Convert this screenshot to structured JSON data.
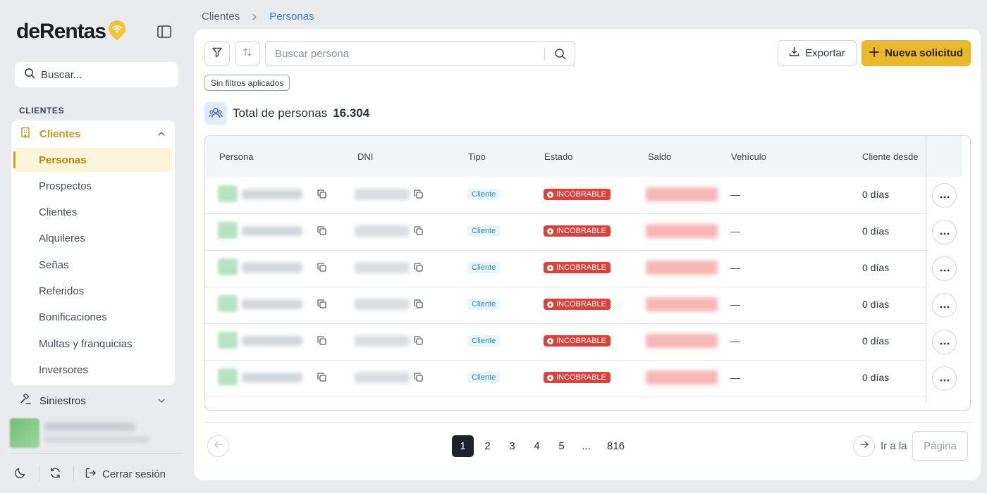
{
  "app": {
    "logo_text": "deRentas",
    "brand_color": "#e9b92a",
    "accent_color": "#3b7dd8"
  },
  "sidebar": {
    "search_placeholder": "Buscar...",
    "section_label": "CLIENTES",
    "group": {
      "label": "Clientes",
      "expanded": true,
      "items": [
        {
          "label": "Personas",
          "active": true
        },
        {
          "label": "Prospectos"
        },
        {
          "label": "Clientes"
        },
        {
          "label": "Alquileres"
        },
        {
          "label": "Señas"
        },
        {
          "label": "Referidos"
        },
        {
          "label": "Bonificaciones"
        },
        {
          "label": "Multas y franquicias"
        },
        {
          "label": "Inversores"
        }
      ]
    },
    "siniestros_label": "Siniestros",
    "footer": {
      "logout_label": "Cerrar sesión"
    }
  },
  "breadcrumb": {
    "root": "Clientes",
    "current": "Personas"
  },
  "toolbar": {
    "search_placeholder": "Buscar persona",
    "export_label": "Exportar",
    "new_label": "Nueva solicitud",
    "filter_chip": "Sin filtros aplicados"
  },
  "summary": {
    "label": "Total de personas",
    "count": "16.304"
  },
  "table": {
    "columns": [
      "Persona",
      "DNI",
      "Tipo",
      "Estado",
      "Saldo",
      "Vehículo",
      "Cliente desde"
    ],
    "rows": [
      {
        "tipo": "Cliente",
        "estado": "INCOBRABLE",
        "vehiculo": "—",
        "desde": "0 días"
      },
      {
        "tipo": "Cliente",
        "estado": "INCOBRABLE",
        "vehiculo": "—",
        "desde": "0 días"
      },
      {
        "tipo": "Cliente",
        "estado": "INCOBRABLE",
        "vehiculo": "—",
        "desde": "0 días"
      },
      {
        "tipo": "Cliente",
        "estado": "INCOBRABLE",
        "vehiculo": "—",
        "desde": "0 días"
      },
      {
        "tipo": "Cliente",
        "estado": "INCOBRABLE",
        "vehiculo": "—",
        "desde": "0 días"
      },
      {
        "tipo": "Cliente",
        "estado": "INCOBRABLE",
        "vehiculo": "—",
        "desde": "0 días"
      }
    ]
  },
  "pagination": {
    "pages": [
      "1",
      "2",
      "3",
      "4",
      "5",
      "...",
      "816"
    ],
    "current": "1",
    "goto_label": "Ir a la",
    "goto_placeholder": "Página"
  }
}
